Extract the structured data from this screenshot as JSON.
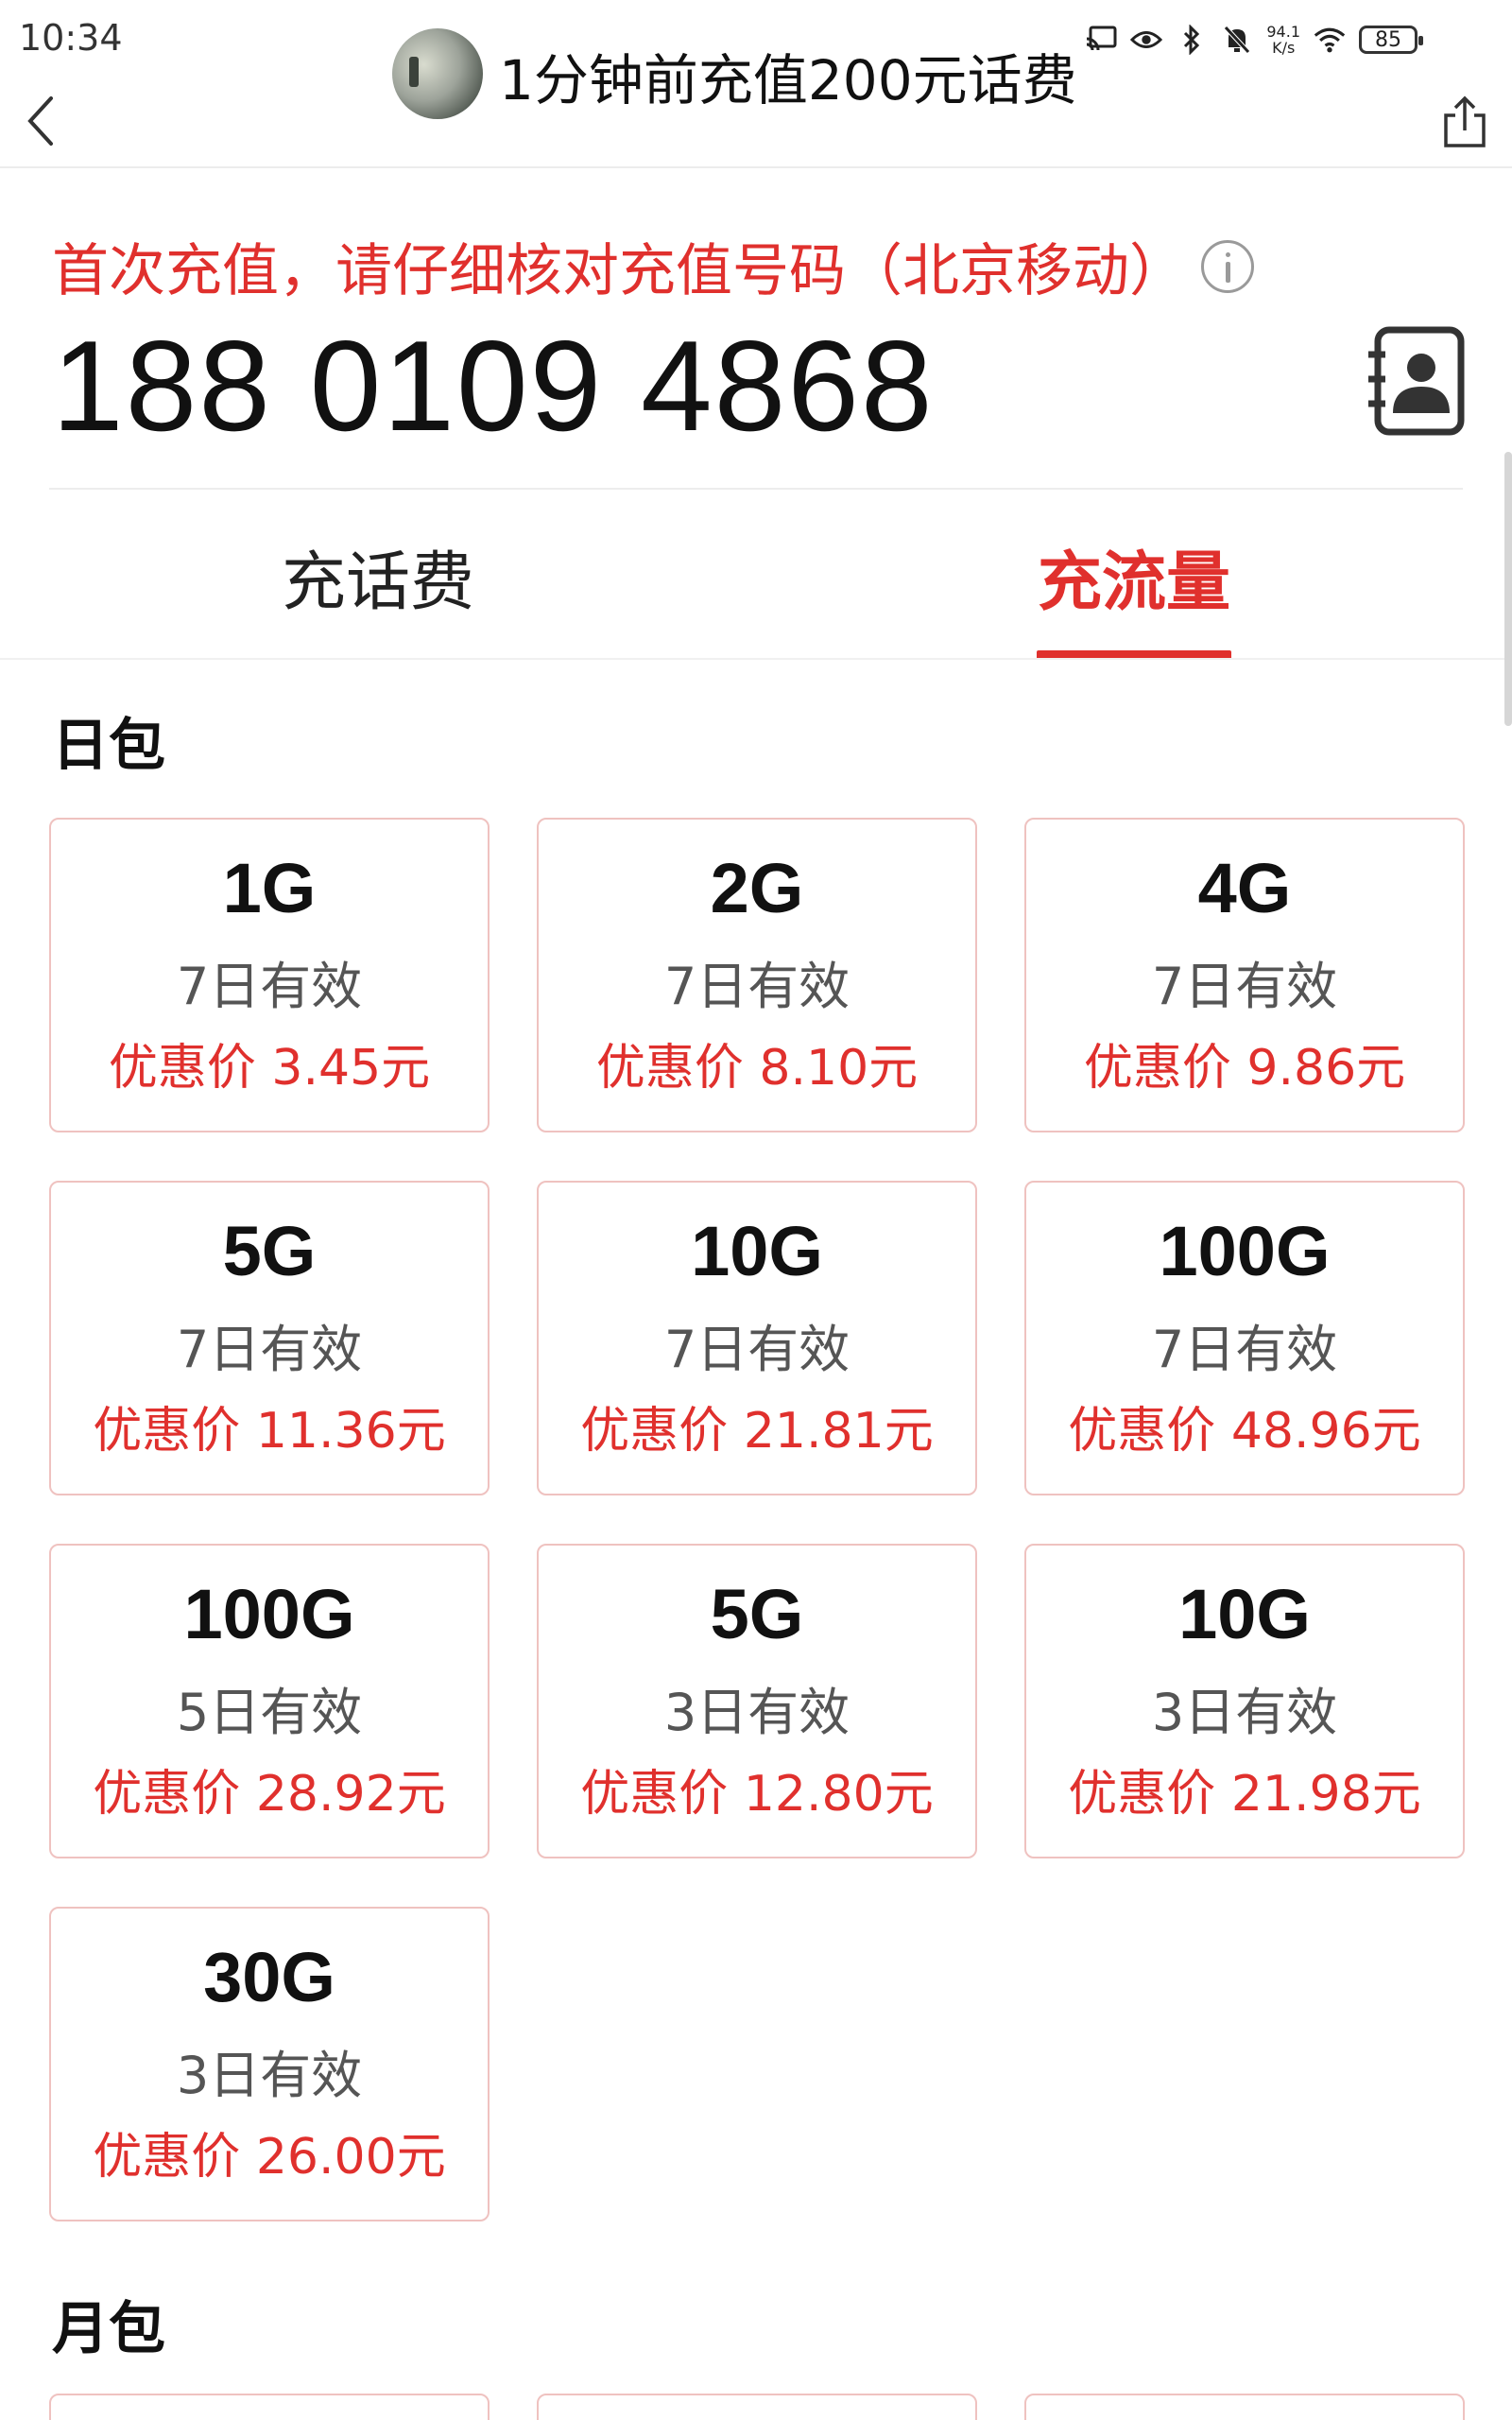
{
  "status_bar": {
    "time": "10:34",
    "network_speed_value": "94.1",
    "network_speed_unit": "K/s",
    "battery": "85"
  },
  "header": {
    "title": "1分钟前充值200元话费"
  },
  "recharge": {
    "notice": "首次充值，请仔细核对充值号码（北京移动）",
    "phone_number": "188 0109 4868"
  },
  "tabs": [
    {
      "label": "充话费",
      "active": false
    },
    {
      "label": "充流量",
      "active": true
    }
  ],
  "colors": {
    "accent": "#e0302d",
    "card_border": "#efc2c0"
  },
  "day_pack": {
    "title": "日包",
    "packages": [
      {
        "size": "1G",
        "validity": "7日有效",
        "price": "优惠价 3.45元"
      },
      {
        "size": "2G",
        "validity": "7日有效",
        "price": "优惠价 8.10元"
      },
      {
        "size": "4G",
        "validity": "7日有效",
        "price": "优惠价 9.86元"
      },
      {
        "size": "5G",
        "validity": "7日有效",
        "price": "优惠价 11.36元"
      },
      {
        "size": "10G",
        "validity": "7日有效",
        "price": "优惠价 21.81元"
      },
      {
        "size": "100G",
        "validity": "7日有效",
        "price": "优惠价 48.96元"
      },
      {
        "size": "100G",
        "validity": "5日有效",
        "price": "优惠价 28.92元"
      },
      {
        "size": "5G",
        "validity": "3日有效",
        "price": "优惠价 12.80元"
      },
      {
        "size": "10G",
        "validity": "3日有效",
        "price": "优惠价 21.98元"
      },
      {
        "size": "30G",
        "validity": "3日有效",
        "price": "优惠价 26.00元"
      }
    ]
  },
  "month_pack": {
    "title": "月包"
  },
  "icons": {
    "back": "chevron-left-icon",
    "share": "share-icon",
    "info": "info-icon",
    "contacts": "contacts-book-icon"
  }
}
